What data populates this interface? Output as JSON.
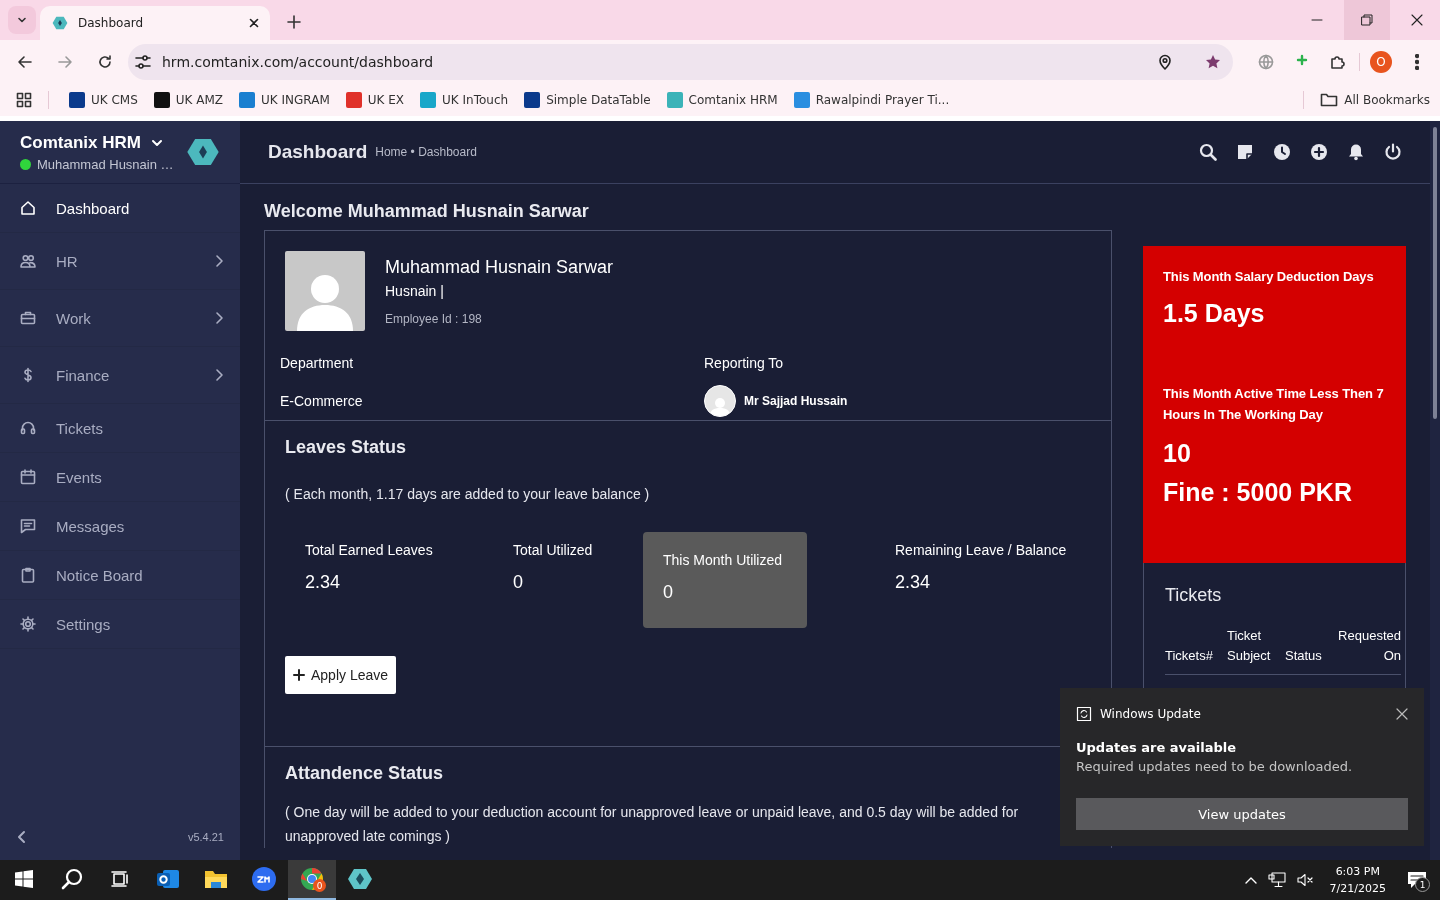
{
  "browser": {
    "tabs": [
      {
        "title": "Dashboard",
        "selected": true
      }
    ],
    "url": "hrm.comtanix.com/account/dashboard",
    "profile_initial": "O",
    "bookmarks": [
      {
        "label": "UK CMS",
        "color": "#0b3a8c"
      },
      {
        "label": "UK AMZ",
        "color": "#111111"
      },
      {
        "label": "UK INGRAM",
        "color": "#1a7fd0"
      },
      {
        "label": "UK EX",
        "color": "#e0312a"
      },
      {
        "label": "UK InTouch",
        "color": "#19a7c9"
      },
      {
        "label": "Simple DataTable",
        "color": "#0b3a8c"
      },
      {
        "label": "Comtanix HRM",
        "color": "#3bb3b8"
      },
      {
        "label": "Rawalpindi Prayer Ti...",
        "color": "#2a8ee0"
      }
    ],
    "all_bookmarks": "All Bookmarks"
  },
  "sidebar": {
    "brand": "Comtanix HRM",
    "user": "Muhammad Husnain …",
    "items": [
      {
        "label": "Dashboard",
        "kind": "home",
        "selected": true,
        "expandable": false
      },
      {
        "label": "HR",
        "kind": "people",
        "selected": false,
        "expandable": true
      },
      {
        "label": "Work",
        "kind": "briefcase",
        "selected": false,
        "expandable": true
      },
      {
        "label": "Finance",
        "kind": "dollar",
        "selected": false,
        "expandable": true
      },
      {
        "label": "Tickets",
        "kind": "headset",
        "selected": false,
        "expandable": false
      },
      {
        "label": "Events",
        "kind": "calendar",
        "selected": false,
        "expandable": false
      },
      {
        "label": "Messages",
        "kind": "chat",
        "selected": false,
        "expandable": false
      },
      {
        "label": "Notice Board",
        "kind": "clipboard",
        "selected": false,
        "expandable": false
      },
      {
        "label": "Settings",
        "kind": "gear",
        "selected": false,
        "expandable": false
      }
    ],
    "version": "v5.4.21"
  },
  "header": {
    "title": "Dashboard",
    "breadcrumb": "Home • Dashboard"
  },
  "welcome": "Welcome Muhammad Husnain Sarwar",
  "profile": {
    "name": "Muhammad Husnain Sarwar",
    "nickname": "Husnain |",
    "employee_id": "Employee Id : 198",
    "department_label": "Department",
    "department": "E-Commerce",
    "reporting_label": "Reporting To",
    "reporting_to": "Mr Sajjad Hussain"
  },
  "leaves": {
    "title": "Leaves Status",
    "note": "( Each month, 1.17 days are added to your leave balance )",
    "stats": [
      {
        "label": "Total Earned Leaves",
        "value": "2.34",
        "highlighted": false
      },
      {
        "label": "Total Utilized",
        "value": "0",
        "highlighted": false
      },
      {
        "label": "This Month Utilized",
        "value": "0",
        "highlighted": true
      },
      {
        "label": "Remaining Leave / Balance",
        "value": "2.34",
        "highlighted": false
      }
    ],
    "apply_button": "Apply Leave"
  },
  "attendance": {
    "title": "Attandence Status",
    "note": "( One day will be added to your deduction account for unapproved leave or unpaid leave, and 0.5 day will be added for unapproved late comings )"
  },
  "alerts": {
    "deduction_label": "This Month Salary Deduction Days",
    "deduction_value": "1.5 Days",
    "active_label": "This Month Active Time Less Then 7 Hours In The Working Day",
    "active_value": "10",
    "fine": "Fine : 5000 PKR"
  },
  "tickets": {
    "title": "Tickets",
    "columns": [
      "Tickets#",
      "Ticket Subject",
      "Status",
      "Requested On"
    ]
  },
  "toast": {
    "app": "Windows Update",
    "title": "Updates are available",
    "message": "Required updates need to be downloaded.",
    "button": "View updates"
  },
  "taskbar": {
    "apps": [
      {
        "kind": "start",
        "selected": false
      },
      {
        "kind": "search",
        "selected": false
      },
      {
        "kind": "task-view",
        "selected": false
      },
      {
        "kind": "mail",
        "selected": false
      },
      {
        "kind": "folder",
        "selected": false
      },
      {
        "kind": "video",
        "selected": false
      },
      {
        "kind": "browser",
        "selected": true,
        "badge": "0"
      },
      {
        "kind": "app",
        "selected": false
      }
    ],
    "time": "6:03 PM",
    "date": "7/21/2025",
    "notifications": "1"
  }
}
